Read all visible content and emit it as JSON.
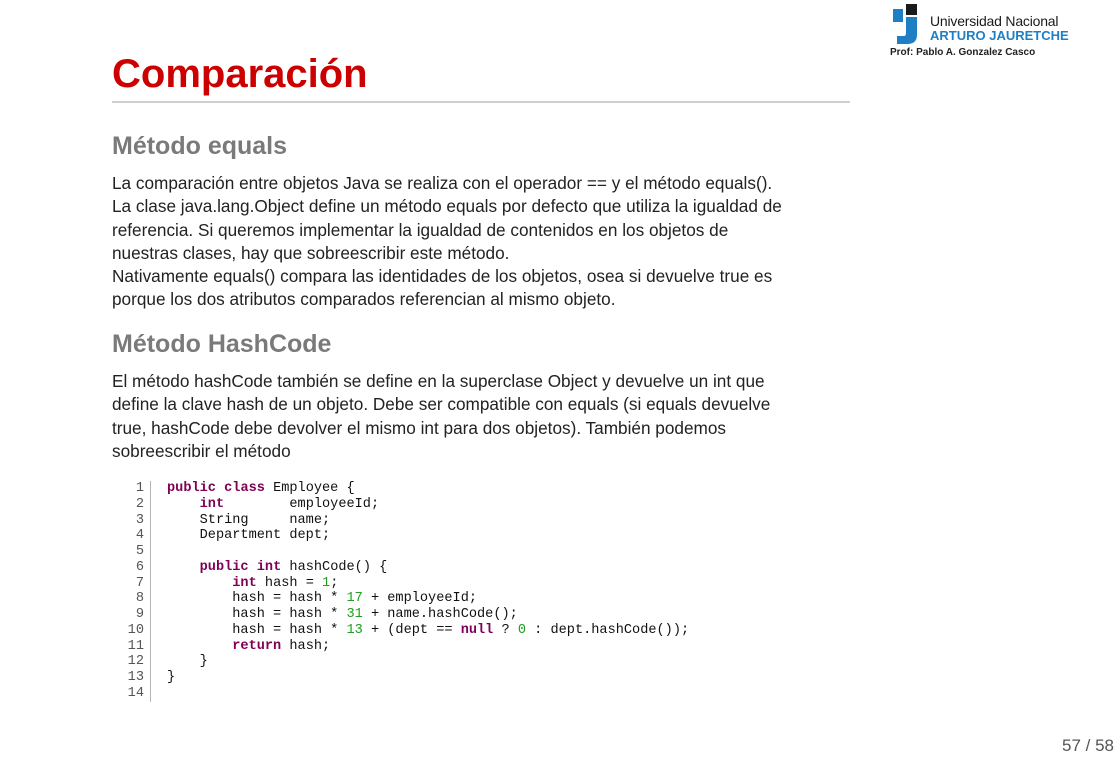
{
  "logo": {
    "university": "Universidad Nacional",
    "name": "ARTURO JAURETCHE",
    "professor": "Prof: Pablo A. Gonzalez Casco"
  },
  "title": "Comparación",
  "sections": [
    {
      "heading": "Método equals",
      "lines": [
        "La comparación entre objetos Java se realiza con el operador == y el método equals().",
        "La clase java.lang.Object define un método equals por defecto que utiliza la igualdad de",
        "referencia. Si queremos implementar la igualdad de contenidos en los objetos de",
        "nuestras clases, hay que sobreescribir este método.",
        "Nativamente equals() compara las identidades de los objetos, osea si devuelve true es",
        "porque los dos atributos comparados referencian al mismo objeto."
      ]
    },
    {
      "heading": "Método HashCode",
      "lines": [
        "El método hashCode también se define en la superclase Object y devuelve un int que",
        "define la clave hash de un objeto. Debe ser compatible con equals (si equals devuelve",
        "true, hashCode debe devolver el mismo int para dos objetos). También podemos",
        "sobreescribir el método"
      ]
    }
  ],
  "code": {
    "line_numbers": [
      "1",
      "2",
      "3",
      "4",
      "5",
      "6",
      "7",
      "8",
      "9",
      "10",
      "11",
      "12",
      "13",
      "14"
    ],
    "lines": [
      [
        {
          "k": "kw",
          "t": "public"
        },
        {
          "k": "p",
          "t": " "
        },
        {
          "k": "kw",
          "t": "class"
        },
        {
          "k": "p",
          "t": " Employee {"
        }
      ],
      [
        {
          "k": "p",
          "t": "    "
        },
        {
          "k": "kw",
          "t": "int"
        },
        {
          "k": "p",
          "t": "        employeeId;"
        }
      ],
      [
        {
          "k": "p",
          "t": "    String     name;"
        }
      ],
      [
        {
          "k": "p",
          "t": "    Department dept;"
        }
      ],
      [],
      [
        {
          "k": "p",
          "t": "    "
        },
        {
          "k": "kw",
          "t": "public"
        },
        {
          "k": "p",
          "t": " "
        },
        {
          "k": "kw",
          "t": "int"
        },
        {
          "k": "p",
          "t": " hashCode() {"
        }
      ],
      [
        {
          "k": "p",
          "t": "        "
        },
        {
          "k": "kw",
          "t": "int"
        },
        {
          "k": "p",
          "t": " hash = "
        },
        {
          "k": "num",
          "t": "1"
        },
        {
          "k": "p",
          "t": ";"
        }
      ],
      [
        {
          "k": "p",
          "t": "        hash = hash * "
        },
        {
          "k": "num",
          "t": "17"
        },
        {
          "k": "p",
          "t": " + employeeId;"
        }
      ],
      [
        {
          "k": "p",
          "t": "        hash = hash * "
        },
        {
          "k": "num",
          "t": "31"
        },
        {
          "k": "p",
          "t": " + name.hashCode();"
        }
      ],
      [
        {
          "k": "p",
          "t": "        hash = hash * "
        },
        {
          "k": "num",
          "t": "13"
        },
        {
          "k": "p",
          "t": " + (dept == "
        },
        {
          "k": "kw",
          "t": "null"
        },
        {
          "k": "p",
          "t": " ? "
        },
        {
          "k": "num",
          "t": "0"
        },
        {
          "k": "p",
          "t": " : dept.hashCode());"
        }
      ],
      [
        {
          "k": "p",
          "t": "        "
        },
        {
          "k": "kw",
          "t": "return"
        },
        {
          "k": "p",
          "t": " hash;"
        }
      ],
      [
        {
          "k": "p",
          "t": "    }"
        }
      ],
      [
        {
          "k": "p",
          "t": "}"
        }
      ],
      []
    ]
  },
  "page": "57 / 58",
  "colors": {
    "title": "#cc0000",
    "heading": "#7a7a7a",
    "keyword": "#7f0055",
    "number": "#1e9e1e",
    "logo_blue": "#1f7fc4"
  }
}
